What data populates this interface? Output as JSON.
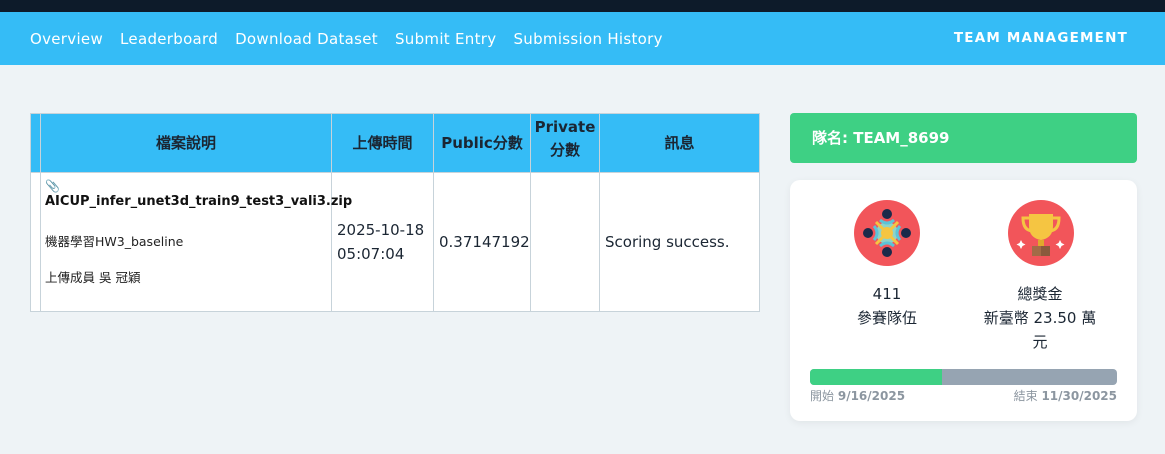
{
  "nav": {
    "items": [
      "Overview",
      "Leaderboard",
      "Download Dataset",
      "Submit Entry",
      "Submission History"
    ],
    "right": "TEAM MANAGEMENT"
  },
  "table": {
    "headers": [
      "檔案說明",
      "上傳時間",
      "Public分數",
      "Private\n分數",
      "訊息"
    ],
    "rows": [
      {
        "file_name": "AICUP_infer_unet3d_train9_test3_vali3.zip",
        "description": "機器學習HW3_baseline",
        "uploader": "上傳成員 吳 冠穎",
        "upload_date": "2025-10-18",
        "upload_time": "05:07:04",
        "public_score": "0.37147192",
        "private_score": "",
        "message": "Scoring success."
      }
    ]
  },
  "team": {
    "label": "隊名: TEAM_8699"
  },
  "stats": {
    "teams_count": "411",
    "teams_label": "參賽隊伍",
    "prize_label": "總獎金",
    "prize_value_line1": "新臺幣 23.50 萬",
    "prize_value_line2": "元",
    "start_label": "開始",
    "start_date": "9/16/2025",
    "end_label": "結束",
    "end_date": "11/30/2025",
    "progress_fraction": 0.43
  },
  "colors": {
    "nav": "#35bcf6",
    "green": "#3ed084",
    "icon_bg": "#f2555a",
    "bar_bg": "#96a4b2"
  },
  "icons": {
    "team": "team-people-icon",
    "prize": "trophy-icon",
    "file": "paperclip-icon"
  }
}
